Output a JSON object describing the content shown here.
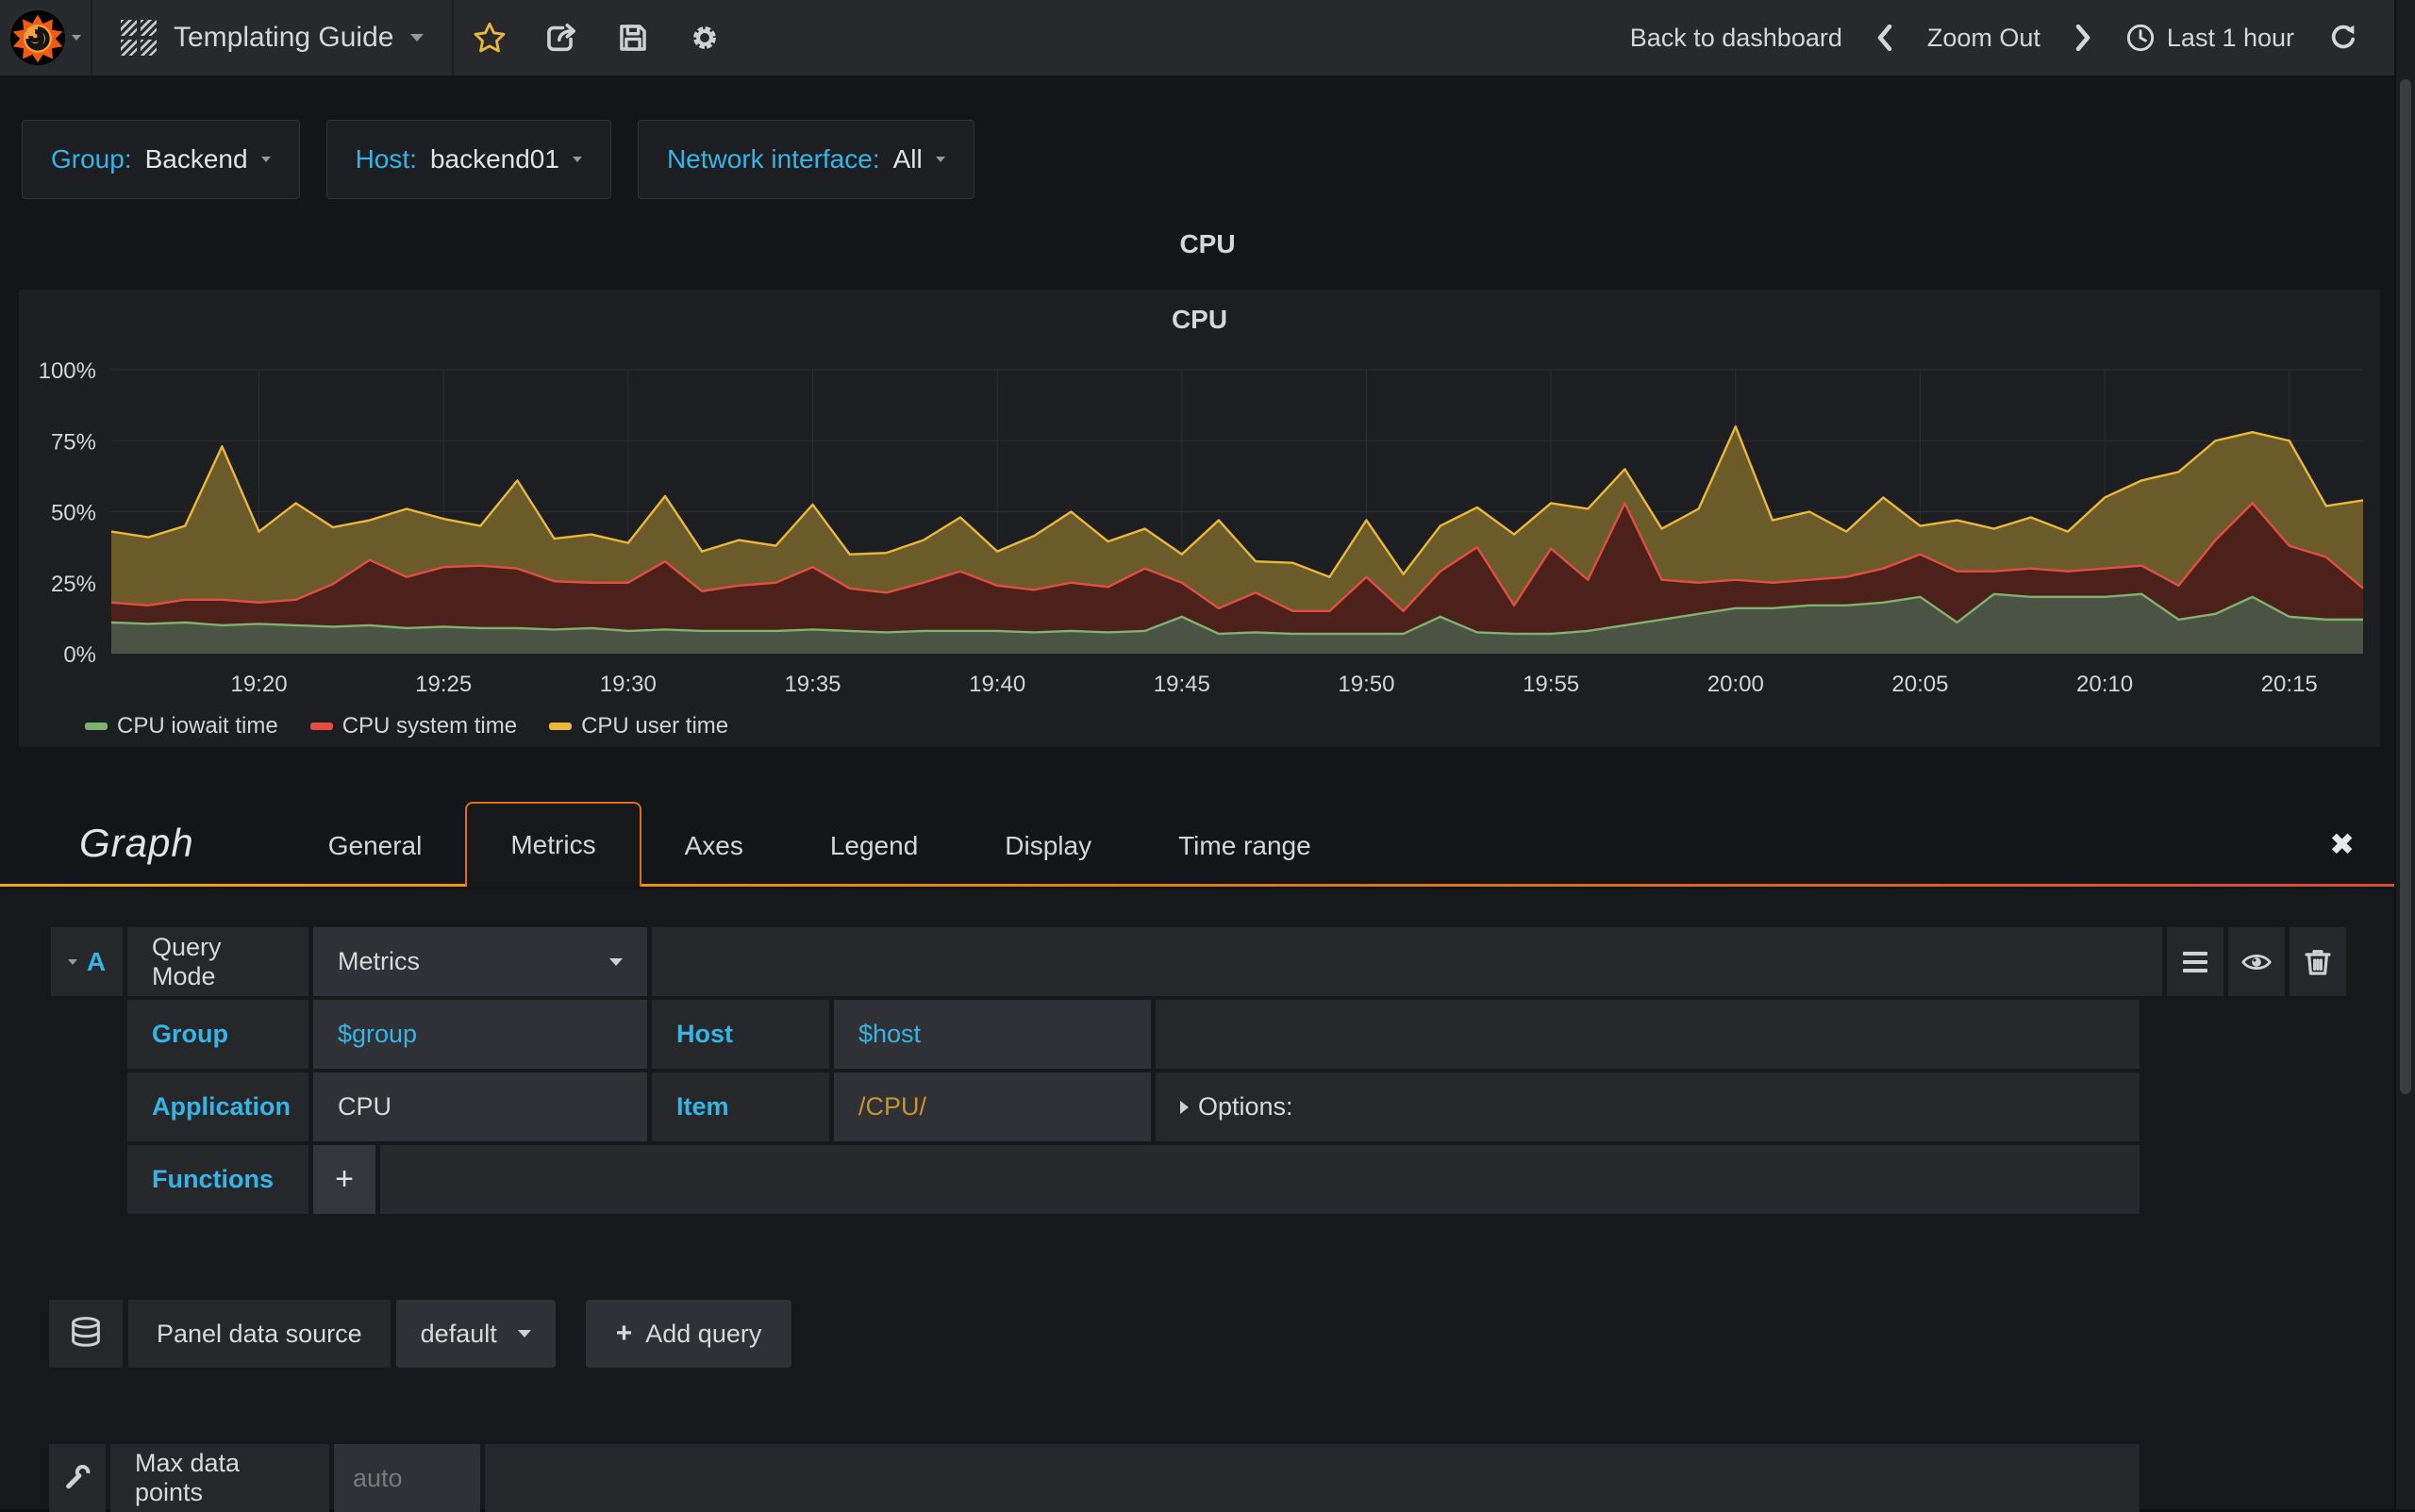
{
  "navbar": {
    "dashboard_title": "Templating Guide",
    "back_to_dashboard": "Back to dashboard",
    "zoom_out": "Zoom Out",
    "time_range": "Last 1 hour",
    "icons": [
      "grafana-logo",
      "dashboard-grid-icon",
      "star-icon",
      "share-icon",
      "save-icon",
      "gear-icon",
      "chevron-left-icon",
      "chevron-right-icon",
      "clock-icon",
      "refresh-icon"
    ],
    "star_color": "#eab839"
  },
  "variables": [
    {
      "label": "Group:",
      "value": "Backend"
    },
    {
      "label": "Host:",
      "value": "backend01"
    },
    {
      "label": "Network interface:",
      "value": "All"
    }
  ],
  "dashboard_row": {
    "title": "CPU"
  },
  "panel": {
    "title": "CPU"
  },
  "chart_data": {
    "type": "area",
    "stacked": true,
    "title": "CPU",
    "unit": "percent",
    "ylim": [
      0,
      100
    ],
    "y_ticks": [
      "0%",
      "25%",
      "50%",
      "75%",
      "100%"
    ],
    "grid": true,
    "legend_position": "bottom-left",
    "x_start": "19:16",
    "x_step_minutes": 1,
    "x_first_tick_index": 4,
    "x_tick_every": 5,
    "x_tick_labels": [
      "19:20",
      "19:25",
      "19:30",
      "19:35",
      "19:40",
      "19:45",
      "19:50",
      "19:55",
      "20:00",
      "20:05",
      "20:10",
      "20:15"
    ],
    "series": [
      {
        "name": "CPU iowait time",
        "color": "#7EB26D",
        "fill": "#4b5444",
        "values": [
          11,
          10.5,
          11,
          10,
          10.5,
          10,
          9.5,
          10,
          9,
          9.5,
          9,
          9,
          8.5,
          9,
          8,
          8.5,
          8,
          8,
          8,
          8.5,
          8,
          7.5,
          8,
          8,
          8,
          7.5,
          8,
          7.5,
          8,
          13,
          7,
          7.5,
          7,
          7,
          7,
          7,
          13,
          7.5,
          7,
          7,
          8,
          10,
          12,
          14,
          16,
          16,
          17,
          17,
          18,
          20,
          11,
          21,
          20,
          20,
          20,
          21,
          12,
          14,
          20,
          13,
          12,
          12
        ]
      },
      {
        "name": "CPU system time",
        "color": "#E24D42",
        "fill": "#4d211b",
        "values": [
          7,
          6.5,
          8,
          9,
          7.5,
          9,
          15,
          23,
          18,
          21,
          22,
          21,
          17,
          16,
          17,
          24,
          14,
          16,
          17,
          22,
          15,
          14,
          17,
          21,
          16,
          15,
          17,
          16,
          22,
          12,
          9,
          14,
          8,
          8,
          20,
          8,
          16,
          30,
          10,
          30,
          18,
          43,
          14,
          11,
          10,
          9,
          9,
          10,
          12,
          15,
          18,
          8,
          10,
          9,
          10,
          10,
          12,
          26,
          33,
          25,
          22,
          11
        ]
      },
      {
        "name": "CPU user time",
        "color": "#EAB839",
        "fill": "#6b5b2b",
        "values": [
          25,
          24,
          26,
          54,
          25,
          34,
          20,
          14,
          24,
          17,
          14,
          31,
          15,
          17,
          14,
          23,
          14,
          16,
          13,
          22,
          12,
          14,
          15,
          19,
          12,
          19,
          25,
          16,
          14,
          10,
          31,
          11,
          17,
          12,
          20,
          13,
          16,
          14,
          25,
          16,
          25,
          12,
          18,
          26,
          54,
          22,
          24,
          16,
          25,
          10,
          18,
          15,
          18,
          14,
          25,
          30,
          40,
          35,
          25,
          37,
          18,
          31
        ]
      }
    ]
  },
  "editor": {
    "panel_type": "Graph",
    "tabs": [
      "General",
      "Metrics",
      "Axes",
      "Legend",
      "Display",
      "Time range"
    ],
    "active_tab": "Metrics",
    "close_label": "✖"
  },
  "query": {
    "ref_letter": "A",
    "mode_label": "Query Mode",
    "mode_value": "Metrics",
    "group_label": "Group",
    "group_value": "$group",
    "host_label": "Host",
    "host_value": "$host",
    "application_label": "Application",
    "application_value": "CPU",
    "item_label": "Item",
    "item_value": "/CPU/",
    "item_value_color": "#c9932a",
    "options_label": "Options:",
    "functions_label": "Functions",
    "add_function_label": "+",
    "row_icons": [
      "menu-icon",
      "eye-icon",
      "trash-icon"
    ]
  },
  "datasource": {
    "label": "Panel data source",
    "value": "default",
    "add_query_plus": "+",
    "add_query_label": "Add query"
  },
  "settings": {
    "max_data_points_label": "Max data points",
    "max_data_points_placeholder": "auto"
  },
  "colors": {
    "accent_blue": "#33b5e5",
    "tab_accent": "#dd6e1d",
    "gradient_left": "#f0a713",
    "gradient_right": "#d44a3a"
  }
}
